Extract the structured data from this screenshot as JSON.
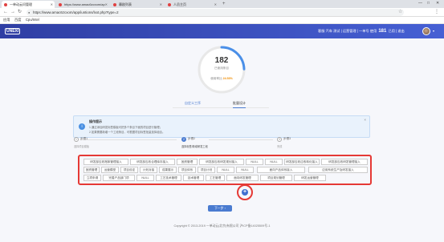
{
  "browser": {
    "tabs": [
      {
        "title": "一单动云问管理"
      },
      {
        "title": "https://www.amac6zcxom/ap"
      },
      {
        "title": "幕剧列表"
      },
      {
        "title": "人员主页"
      }
    ],
    "new_tab": "+",
    "window_controls": [
      "—",
      "□",
      "✕"
    ],
    "url": "https://www.amac6zcxom/app/iuntions/lxxt.php?type=2",
    "bookmarks": [
      {
        "label": "应用"
      },
      {
        "label": "百度"
      },
      {
        "label": "Cpu/Intel"
      }
    ]
  },
  "header": {
    "logo": "UNEXI",
    "user_text_prefix": "客服 汽车 测试 | 运营管理 | 一单号 使用",
    "user_count": "181",
    "user_text_suffix": "已用 | 退出"
  },
  "summary": {
    "count": "182",
    "count_label": "已使用条目",
    "percent_label": "使用率比",
    "percent_value": "24.53%",
    "progress": 0.2453
  },
  "subtabs": [
    {
      "label": "自定义工序"
    },
    {
      "label": "批量设计"
    }
  ],
  "info": {
    "title": "操作提示",
    "lines": [
      "1.通过添加研发标签模板可把多个条目下面的项目进行管理；",
      "2.如果需要新增一个工段条目，可根据项目标签批量选择组合。"
    ],
    "close": "×"
  },
  "steps": [
    {
      "num": "1",
      "label": "步骤1",
      "desc": "选择项目模板"
    },
    {
      "num": "2",
      "label": "步骤2",
      "desc": "选择标签/新增研发工段"
    },
    {
      "num": "3",
      "label": "步骤3",
      "desc": "完成"
    }
  ],
  "chips": [
    [
      "研发部应收账款管理接入",
      "研发部应收合理库存接入",
      "固资管理",
      "研发部应收研发规划接入",
      "NULL",
      "NULL",
      "研发部应收应收转化接入",
      "研发部应收研发管理接入"
    ],
    [
      "固资管理",
      "运营模型",
      "项目设定",
      "计划对接",
      "成果展示",
      "项目体系",
      "项目计划",
      "NULL",
      "NULL",
      "面向产品体系接入",
      "应用系统生产及研发接入"
    ],
    [
      "立项申请",
      "完善产品部门项",
      "NULL",
      "工艺技术管理",
      "技术管理",
      "工艺管理",
      "面向研发管理",
      "项目规划管理",
      "研发运营管理"
    ]
  ],
  "actions": {
    "add": "+",
    "next": "下一步 ›"
  },
  "footer": "Copyright © 2013-2019 一单动云(北京)有限公司 沪ICP备14025509号-1"
}
